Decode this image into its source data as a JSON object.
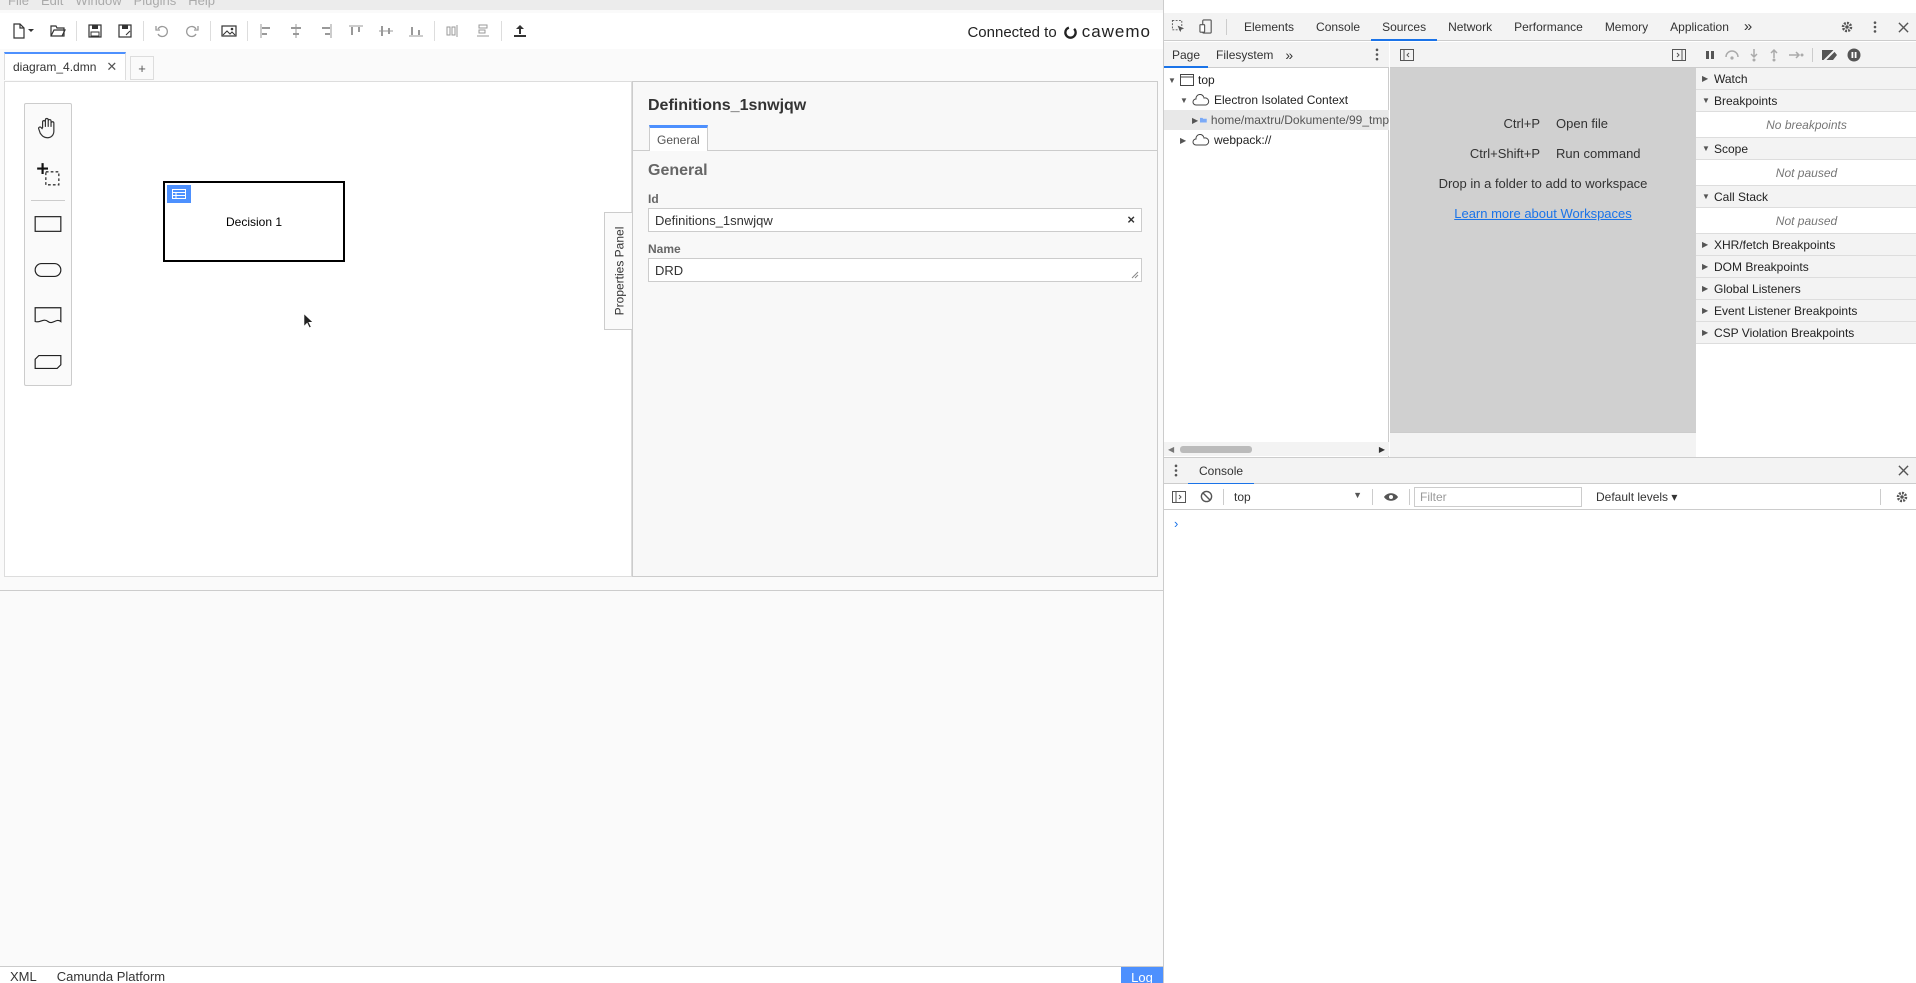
{
  "menu": [
    "File",
    "Edit",
    "Window",
    "Plugins",
    "Help"
  ],
  "connected": {
    "label": "Connected to",
    "brand": "cawemo"
  },
  "doc_tab": {
    "name": "diagram_4.dmn",
    "close": "✕",
    "add": "+"
  },
  "decision": {
    "label": "Decision 1"
  },
  "properties": {
    "toggle_label": "Properties Panel",
    "title": "Definitions_1snwjqw",
    "tab": "General",
    "group": "General",
    "id_label": "Id",
    "id_value": "Definitions_1snwjqw",
    "name_label": "Name",
    "name_value": "DRD",
    "clear": "×"
  },
  "status": {
    "xml": "XML",
    "platform": "Camunda Platform",
    "log": "Log"
  },
  "devtools": {
    "tabs": [
      "Elements",
      "Console",
      "Sources",
      "Network",
      "Performance",
      "Memory",
      "Application"
    ],
    "active_tab": "Sources",
    "more": "»",
    "nav_tabs": [
      "Page",
      "Filesystem"
    ],
    "tree": [
      "top",
      "Electron Isolated Context",
      "home/maxtru/Dokumente/99_tmp",
      "webpack://"
    ],
    "shortcuts": [
      {
        "keys": "Ctrl+P",
        "action": "Open file"
      },
      {
        "keys": "Ctrl+Shift+P",
        "action": "Run command"
      }
    ],
    "drop_text": "Drop in a folder to add to workspace",
    "workspace_link": "Learn more about Workspaces",
    "sections": [
      {
        "name": "Watch",
        "body": ""
      },
      {
        "name": "Breakpoints",
        "body": "No breakpoints"
      },
      {
        "name": "Scope",
        "body": "Not paused"
      },
      {
        "name": "Call Stack",
        "body": "Not paused"
      },
      {
        "name": "XHR/fetch Breakpoints",
        "body": ""
      },
      {
        "name": "DOM Breakpoints",
        "body": ""
      },
      {
        "name": "Global Listeners",
        "body": ""
      },
      {
        "name": "Event Listener Breakpoints",
        "body": ""
      },
      {
        "name": "CSP Violation Breakpoints",
        "body": ""
      }
    ],
    "drawer_tab": "Console",
    "context": "top",
    "filter_placeholder": "Filter",
    "levels": "Default levels ▾",
    "prompt": "›"
  },
  "colors": {
    "accent": "#4d90fe",
    "devtools_blue": "#1a73e8"
  }
}
